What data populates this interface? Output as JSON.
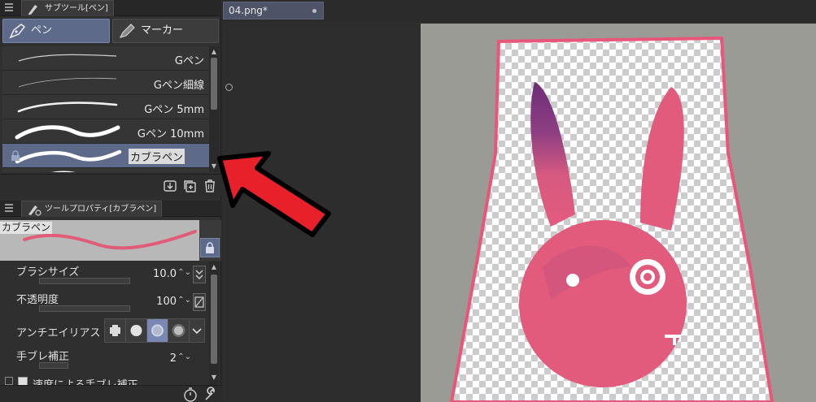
{
  "subtool_panel": {
    "tab_title": "サブツール[ペン]",
    "groups": [
      {
        "label": "ペン",
        "selected": true
      },
      {
        "label": "マーカー",
        "selected": false
      }
    ],
    "brushes": [
      {
        "name": "Gペン"
      },
      {
        "name": "Gペン細線"
      },
      {
        "name": "Gペン 5mm"
      },
      {
        "name": "Gペン 10mm"
      },
      {
        "name": "カブラペン",
        "selected": true,
        "locked": true
      }
    ]
  },
  "tool_property_panel": {
    "tab_title": "ツールプロパティ[カブラペン]",
    "preview_label": "カブラペン",
    "properties": {
      "brush_size": {
        "label": "ブラシサイズ",
        "value": "10.0"
      },
      "opacity": {
        "label": "不透明度",
        "value": "100"
      },
      "antialias": {
        "label": "アンチエイリアス",
        "options": [
          "none",
          "weak",
          "medium",
          "strong"
        ],
        "selected_index": 2
      },
      "stabilization": {
        "label": "手ブレ補正",
        "value": "2"
      },
      "speed_stabilization": {
        "label": "速度による手ブレ補正",
        "checked": true
      }
    }
  },
  "document": {
    "tab_title": "04.png*"
  },
  "colors": {
    "accent": "#5d6a8a",
    "annotation_arrow": "#e8202a",
    "rabbit": "#e25b7c",
    "rabbit_ear_tip": "#6e2d78",
    "outline": "#e8567a"
  }
}
